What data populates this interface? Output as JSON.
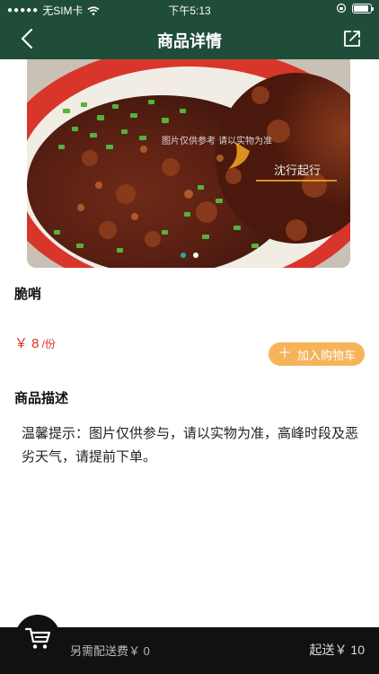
{
  "status_bar": {
    "carrier": "无SIM卡",
    "time": "下午5:13",
    "battery_level": 0.9
  },
  "nav": {
    "title": "商品详情",
    "back_icon": "chevron-left-icon",
    "share_icon": "share-icon"
  },
  "gallery": {
    "image_count": 2,
    "active_index": 0,
    "overlay_text": "图片仅供参考 请以实物为准",
    "watermark": "沈行起行"
  },
  "product": {
    "name": "脆哨",
    "price": "￥ 8",
    "unit": "/份",
    "add_to_cart_label": "加入购物车"
  },
  "description": {
    "title": "商品描述",
    "text": "温馨提示：图片仅供参与，请以实物为准，高峰时段及恶劣天气，请提前下单。"
  },
  "cart_bar": {
    "delivery_fee_text": "另需配送费￥ 0",
    "min_order_text": "起送￥ 10"
  },
  "colors": {
    "header": "#1f4d3a",
    "price": "#e2302a",
    "add_to_cart": "#f6b45a",
    "bottom_bar": "#111111"
  }
}
